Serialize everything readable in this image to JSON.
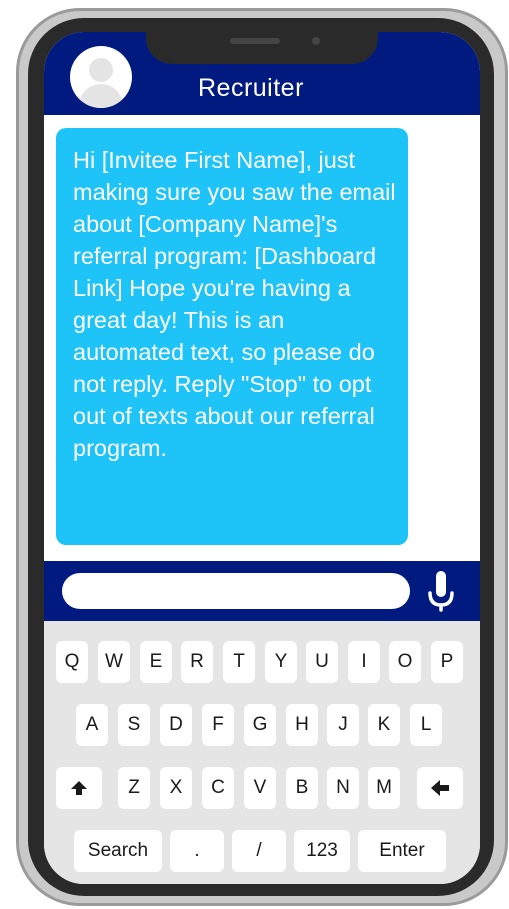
{
  "header": {
    "contact_name": "Recruiter"
  },
  "message": {
    "text": "Hi [Invitee First Name], just making sure you saw the email about [Company Name]'s referral program: [Dashboard Link] Hope you're having a great day! This is an automated text, so please do not reply. Reply \"Stop\" to opt out of texts about our referral program."
  },
  "input": {
    "value": "",
    "placeholder": ""
  },
  "keyboard": {
    "row1": [
      "Q",
      "W",
      "E",
      "R",
      "T",
      "Y",
      "U",
      "I",
      "O",
      "P"
    ],
    "row2": [
      "A",
      "S",
      "D",
      "F",
      "G",
      "H",
      "J",
      "K",
      "L"
    ],
    "row3": [
      "Z",
      "X",
      "C",
      "V",
      "B",
      "N",
      "M"
    ],
    "shift_icon": "arrow-up-icon",
    "backspace_icon": "arrow-left-icon",
    "row4": [
      "Search",
      ".",
      "/",
      "123",
      "Enter"
    ]
  },
  "colors": {
    "header": "#001a7f",
    "bubble": "#1ec3f7",
    "keyboard": "#e5e5e5"
  }
}
